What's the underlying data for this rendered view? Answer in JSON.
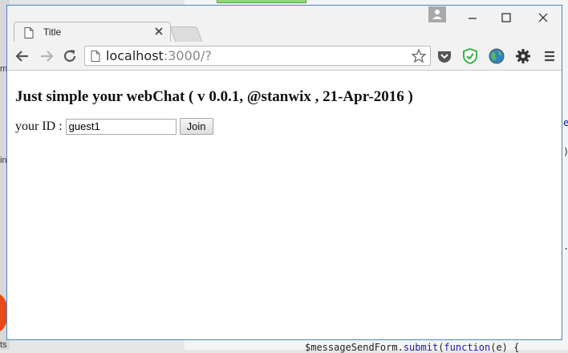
{
  "browser": {
    "tab_title": "Title",
    "url_host": "localhost",
    "url_rest": ":3000/?"
  },
  "page": {
    "heading": "Just simple your webChat ( v 0.0.1, @stanwix , 21-Apr-2016 )",
    "id_label": "your ID :",
    "id_value": "guest1",
    "join_label": "Join"
  },
  "background": {
    "code_line_prefix": "$messageSendForm.",
    "code_line_kw1": "submit",
    "code_line_mid": "(",
    "code_line_kw2": "function",
    "code_line_suffix": "(e) {",
    "right_frag_1": "e",
    "right_frag_2": ")",
    "right_frag_3": ".",
    "left_frag_1": "m",
    "left_frag_2": "in",
    "left_frag_3": "ts"
  },
  "icons": {
    "tab": "page-icon",
    "close": "close-icon",
    "back": "back-arrow-icon",
    "forward": "forward-arrow-icon",
    "reload": "reload-icon",
    "star": "star-icon",
    "pocket": "pocket-icon",
    "adguard": "shield-check-icon",
    "globe": "globe-icon",
    "settings": "gear-icon",
    "menu": "hamburger-menu-icon"
  },
  "colors": {
    "window_border": "#4a86c8",
    "shield_green": "#3bb54a",
    "pocket_dark": "#555555"
  }
}
